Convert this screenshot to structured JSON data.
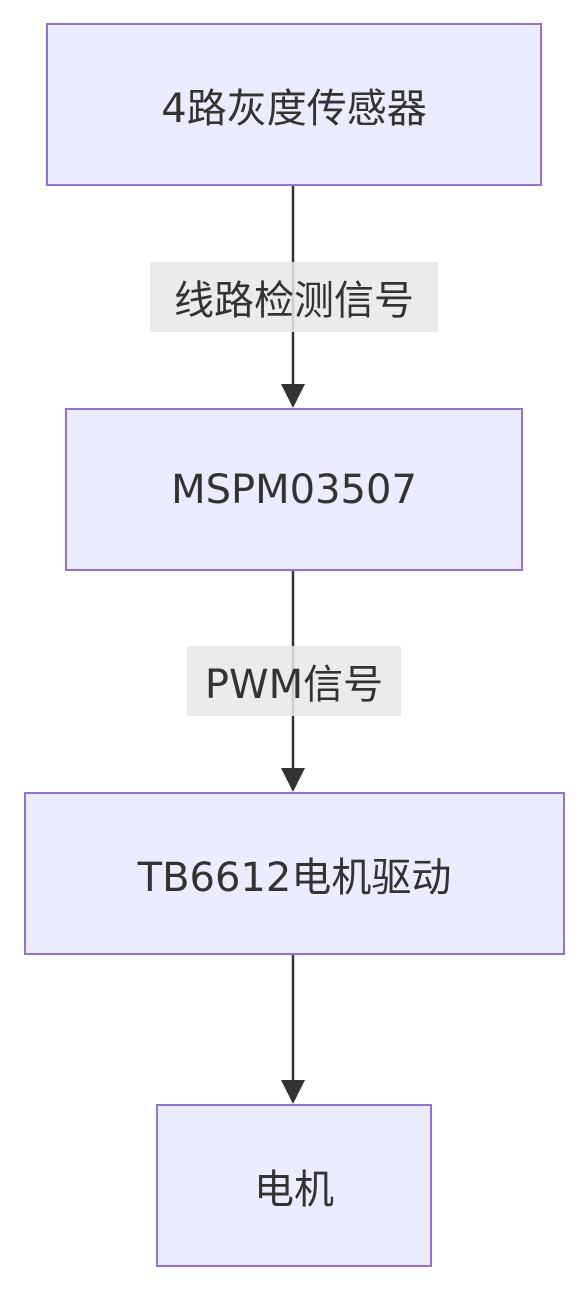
{
  "nodes": [
    {
      "id": "sensor",
      "label": "4路灰度传感器"
    },
    {
      "id": "mcu",
      "label": "MSPM03507"
    },
    {
      "id": "driver",
      "label": "TB6612电机驱动"
    },
    {
      "id": "motor",
      "label": "电机"
    }
  ],
  "edges": [
    {
      "from": "sensor",
      "to": "mcu",
      "label": "线路检测信号"
    },
    {
      "from": "mcu",
      "to": "driver",
      "label": "PWM信号"
    },
    {
      "from": "driver",
      "to": "motor",
      "label": ""
    }
  ],
  "colors": {
    "node_fill": "#ECECFF",
    "node_stroke": "#9370DB",
    "edge": "#333333",
    "label_bg": "#E8E8E8"
  }
}
